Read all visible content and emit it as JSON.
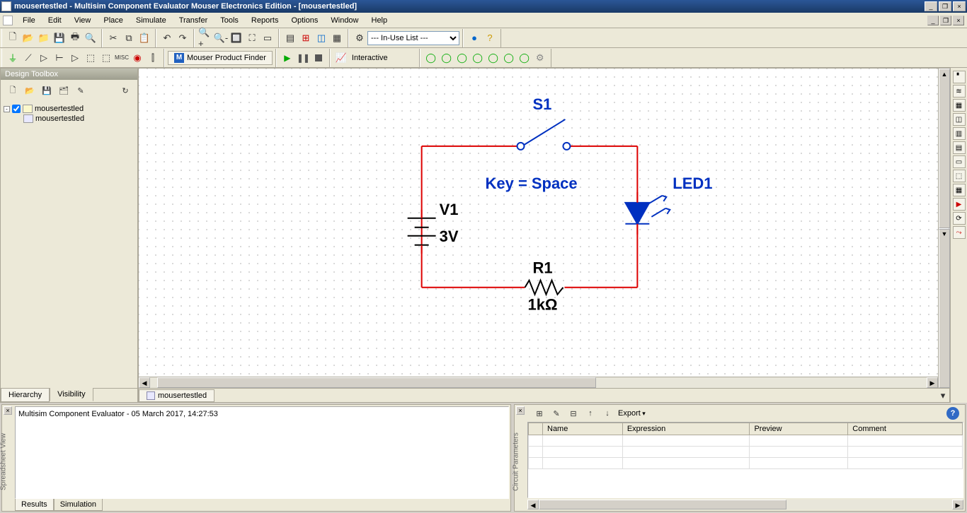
{
  "title": "mousertestled - Multisim Component Evaluator Mouser Electronics Edition - [mousertestled]",
  "menus": [
    "File",
    "Edit",
    "View",
    "Place",
    "Simulate",
    "Transfer",
    "Tools",
    "Reports",
    "Options",
    "Window",
    "Help"
  ],
  "toolbar": {
    "inuse_label": "--- In-Use List ---",
    "mouser_btn": "Mouser Product Finder",
    "interactive": "Interactive"
  },
  "left_panel": {
    "title": "Design Toolbox",
    "tree_root": "mousertestled",
    "tree_child": "mousertestled",
    "tabs": [
      "Hierarchy",
      "Visibility"
    ]
  },
  "doc_tab": "mousertestled",
  "schematic": {
    "V1_label": "V1",
    "V1_value": "3V",
    "S1_label": "S1",
    "S1_key": "Key = Space",
    "R1_label": "R1",
    "R1_value": "1kΩ",
    "LED1_label": "LED1"
  },
  "bottom_left": {
    "text": "Multisim Component Evaluator  -  05 March 2017, 14:27:53",
    "tabs": [
      "Results",
      "Simulation"
    ],
    "vert": "Spreadsheet View"
  },
  "bottom_right": {
    "export": "Export",
    "columns": [
      "Name",
      "Expression",
      "Preview",
      "Comment"
    ],
    "vert": "Circuit Parameters"
  }
}
